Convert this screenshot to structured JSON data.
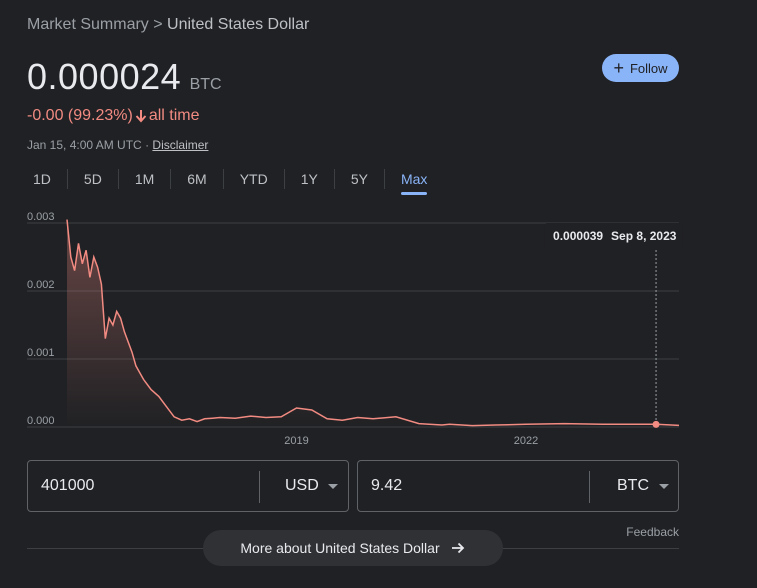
{
  "breadcrumb": {
    "parent": "Market Summary",
    "separator": ">",
    "current": "United States Dollar"
  },
  "price": {
    "value": "0.000024",
    "unit": "BTC"
  },
  "follow": {
    "label": "Follow",
    "icon": "plus-icon"
  },
  "change": {
    "text": "-0.00 (99.23%)",
    "period": "all time",
    "direction": "down",
    "color": "#f28b82"
  },
  "meta": {
    "timestamp": "Jan 15, 4:00 AM UTC",
    "dot": "·",
    "disclaimer": "Disclaimer"
  },
  "tabs": [
    {
      "label": "1D",
      "active": false
    },
    {
      "label": "5D",
      "active": false
    },
    {
      "label": "1M",
      "active": false
    },
    {
      "label": "6M",
      "active": false
    },
    {
      "label": "YTD",
      "active": false
    },
    {
      "label": "1Y",
      "active": false
    },
    {
      "label": "5Y",
      "active": false
    },
    {
      "label": "Max",
      "active": true
    }
  ],
  "chart_data": {
    "type": "line",
    "x_ticks": [
      "2019",
      "2022"
    ],
    "y_ticks": [
      "0.003",
      "0.002",
      "0.001",
      "0.000"
    ],
    "ylim": [
      0,
      0.003
    ],
    "grid": true,
    "line_color": "#f28b82",
    "tooltip": {
      "value": "0.000039",
      "date": "Sep 8, 2023"
    },
    "series": [
      {
        "x": [
          2016.0,
          2016.05,
          2016.1,
          2016.15,
          2016.2,
          2016.25,
          2016.3,
          2016.35,
          2016.4,
          2016.45,
          2016.5,
          2016.55,
          2016.6,
          2016.65,
          2016.7,
          2016.75,
          2016.8,
          2016.85,
          2016.9,
          2016.95,
          2017.0,
          2017.1,
          2017.2,
          2017.3,
          2017.4,
          2017.5,
          2017.6,
          2017.7,
          2017.8,
          2017.9,
          2018.0,
          2018.2,
          2018.4,
          2018.6,
          2018.8,
          2019.0,
          2019.2,
          2019.4,
          2019.6,
          2019.8,
          2020.0,
          2020.3,
          2020.6,
          2020.9,
          2021.0,
          2021.3,
          2021.6,
          2022.0,
          2022.5,
          2023.0,
          2023.5,
          2023.7,
          2024.0
        ],
        "y": [
          0.00305,
          0.0025,
          0.0023,
          0.0027,
          0.0024,
          0.0026,
          0.0022,
          0.0025,
          0.00235,
          0.0021,
          0.0013,
          0.0016,
          0.0015,
          0.0017,
          0.0016,
          0.0014,
          0.00125,
          0.0011,
          0.0009,
          0.0008,
          0.0007,
          0.00055,
          0.00045,
          0.0003,
          0.00015,
          0.0001,
          0.00012,
          8e-05,
          0.00012,
          0.00013,
          0.00014,
          0.00013,
          0.00016,
          0.00014,
          0.00015,
          0.00028,
          0.00025,
          0.00012,
          0.0001,
          0.00014,
          0.00012,
          0.00015,
          5e-05,
          3e-05,
          4e-05,
          2e-05,
          3e-05,
          4e-05,
          5e-05,
          4e-05,
          4e-05,
          3.9e-05,
          2.4e-05
        ]
      }
    ]
  },
  "converter": {
    "left": {
      "value": "401000",
      "currency": "USD"
    },
    "right": {
      "value": "9.42",
      "currency": "BTC"
    }
  },
  "feedback": "Feedback",
  "more": {
    "label": "More about United States Dollar",
    "icon": "arrow-right-icon"
  }
}
